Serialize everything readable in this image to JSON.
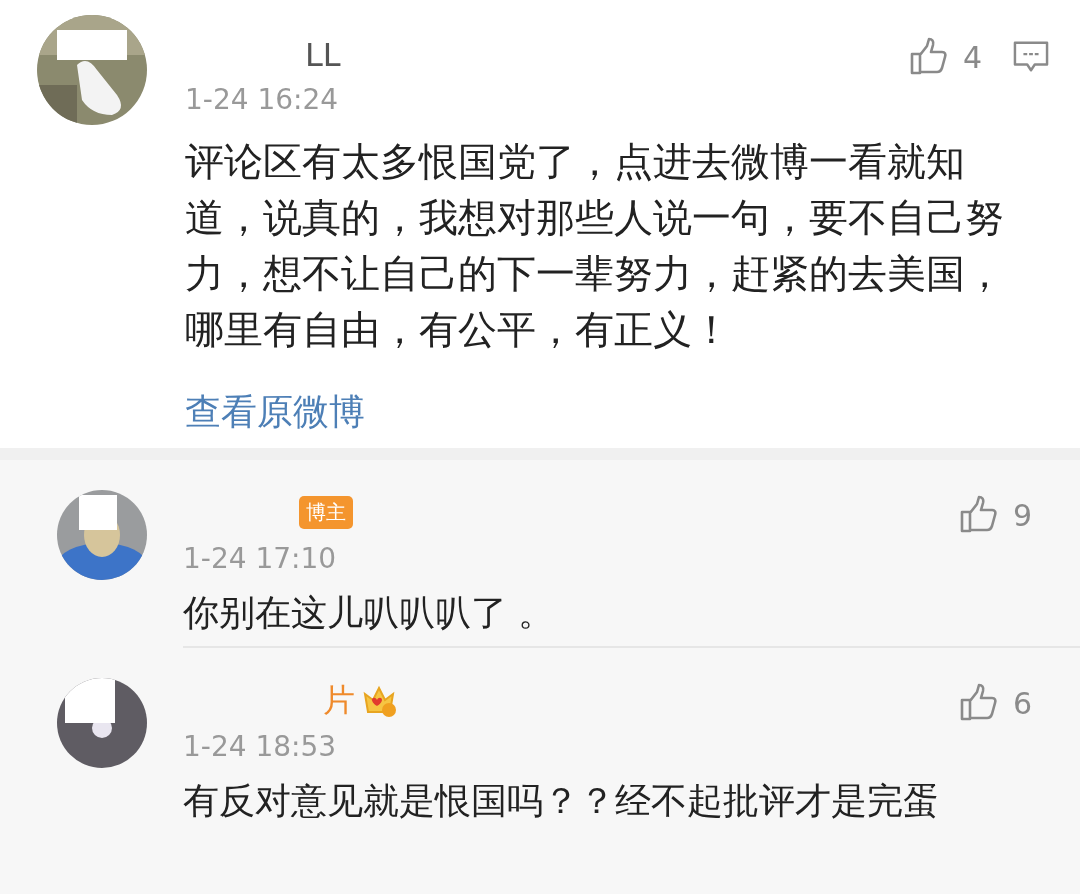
{
  "comment": {
    "name": "LL",
    "time": "1-24 16:24",
    "likes": "4",
    "text": "评论区有太多恨国党了，点进去微博一看就知道，说真的，我想对那些人说一句，要不自己努力，想不让自己的下一辈努力，赶紧的去美国，哪里有自由，有公平，有正义！",
    "link": "查看原微博"
  },
  "replies": [
    {
      "badge": "博主",
      "vip": false,
      "time": "1-24 17:10",
      "likes": "9",
      "text": "你别在这儿叭叭叭了 。"
    },
    {
      "name": "片",
      "vip": true,
      "time": "1-24 18:53",
      "likes": "6",
      "text": "有反对意见就是恨国吗？？经不起批评才是完蛋"
    }
  ]
}
